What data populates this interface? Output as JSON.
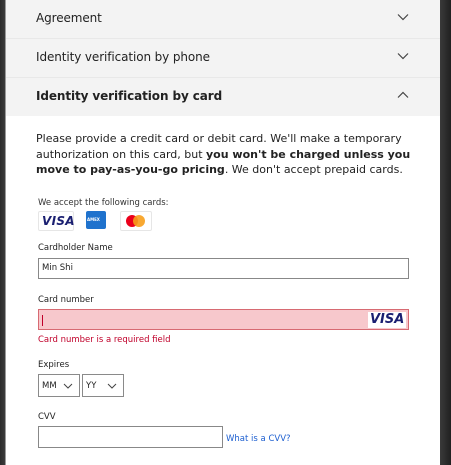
{
  "accordion": {
    "items": [
      {
        "label": "Agreement",
        "state": "collapsed"
      },
      {
        "label": "Identity verification by phone",
        "state": "collapsed"
      },
      {
        "label": "Identity verification by card",
        "state": "expanded"
      }
    ]
  },
  "card_section": {
    "intro_pre": "Please provide a credit card or debit card. We'll make a temporary authorization on this card, but ",
    "intro_bold": "you won't be charged unless you move to pay-as-you-go pricing",
    "intro_post": ". We don't accept prepaid cards.",
    "accept_label": "We accept the following cards:",
    "card_brands": [
      "VISA",
      "AMEX",
      "Mastercard"
    ],
    "cardholder": {
      "label": "Cardholder Name",
      "value": "Min Shi"
    },
    "card_number": {
      "label": "Card number",
      "value": "",
      "brand_badge": "VISA",
      "error": "Card number is a required field"
    },
    "expires": {
      "label": "Expires",
      "month": "MM",
      "year": "YY"
    },
    "cvv": {
      "label": "CVV",
      "value": "",
      "help_link": "What is a CVV?"
    }
  },
  "colors": {
    "error": "#c0002a",
    "error_bg": "#f7c8cc",
    "link": "#1d5fd0",
    "visa_blue": "#1a1f71"
  }
}
